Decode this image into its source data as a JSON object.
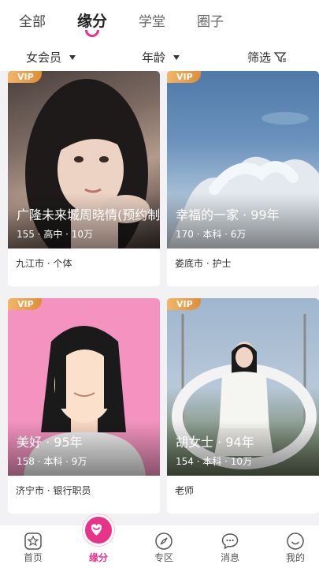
{
  "tabs": [
    "全部",
    "缘分",
    "学堂",
    "圈子"
  ],
  "filters": {
    "membership": "女会员",
    "age": "年龄",
    "screen": "筛选"
  },
  "cards": [
    {
      "badge": "VIP",
      "name": "广隆未来城周晓情(预约制",
      "meta": "155 · 高中 · 10万",
      "footer": "九江市 · 个体"
    },
    {
      "badge": "VIP",
      "name": "幸福的一家 · 99年",
      "meta": "170 · 本科 · 6万",
      "footer": "娄底市 · 护士"
    },
    {
      "badge": "VIP",
      "name": "美好 · 95年",
      "meta": "158 · 本科 · 9万",
      "footer": "济宁市 · 银行职员"
    },
    {
      "badge": "VIP",
      "name": "胡女士 · 94年",
      "meta": "154 · 本科 · 10万",
      "footer": "老师"
    }
  ],
  "nav": [
    "首页",
    "缘分",
    "专区",
    "消息",
    "我的"
  ],
  "colors": {
    "accent": "#e8338a",
    "vip": "#e8993f"
  }
}
